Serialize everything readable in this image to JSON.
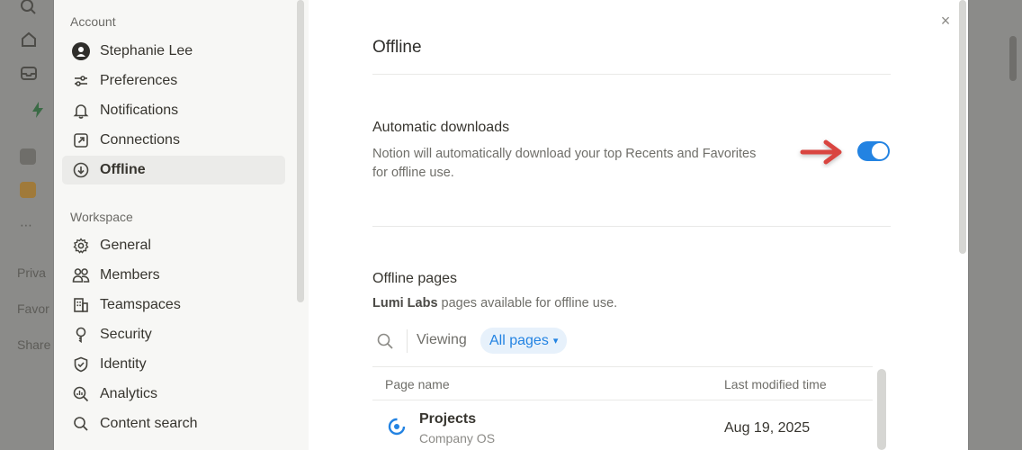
{
  "background": {
    "items": [
      {
        "icon": "search-icon"
      },
      {
        "icon": "home-icon"
      },
      {
        "icon": "inbox-icon"
      },
      {
        "icon": "bolt-icon"
      },
      {
        "icon": "page-icon"
      },
      {
        "icon": "project-icon"
      },
      {
        "icon": "more-icon"
      }
    ],
    "labels": [
      "Priva",
      "Favor",
      "Share"
    ]
  },
  "sidebar": {
    "account_header": "Account",
    "workspace_header": "Workspace",
    "account_items": [
      {
        "label": "Stephanie Lee",
        "icon": "avatar-icon"
      },
      {
        "label": "Preferences",
        "icon": "sliders-icon"
      },
      {
        "label": "Notifications",
        "icon": "bell-icon"
      },
      {
        "label": "Connections",
        "icon": "external-link-icon"
      },
      {
        "label": "Offline",
        "icon": "download-icon",
        "active": true
      }
    ],
    "workspace_items": [
      {
        "label": "General",
        "icon": "gear-icon"
      },
      {
        "label": "Members",
        "icon": "people-icon"
      },
      {
        "label": "Teamspaces",
        "icon": "building-icon"
      },
      {
        "label": "Security",
        "icon": "key-icon"
      },
      {
        "label": "Identity",
        "icon": "shield-icon"
      },
      {
        "label": "Analytics",
        "icon": "analytics-icon"
      },
      {
        "label": "Content search",
        "icon": "search-icon"
      }
    ]
  },
  "content": {
    "title": "Offline",
    "auto_downloads": {
      "heading": "Automatic downloads",
      "description": "Notion will automatically download your top Recents and Favorites for offline use.",
      "enabled": true
    },
    "offline_pages": {
      "heading": "Offline pages",
      "workspace_name": "Lumi Labs",
      "subtitle_rest": " pages available for offline use.",
      "viewing_label": "Viewing",
      "filter_value": "All pages",
      "columns": [
        "Page name",
        "Last modified time"
      ],
      "rows": [
        {
          "name": "Projects",
          "parent": "Company OS",
          "modified": "Aug 19, 2025"
        }
      ]
    },
    "close_label": "×"
  },
  "colors": {
    "accent": "#2383e2",
    "arrow": "#d9453f"
  }
}
